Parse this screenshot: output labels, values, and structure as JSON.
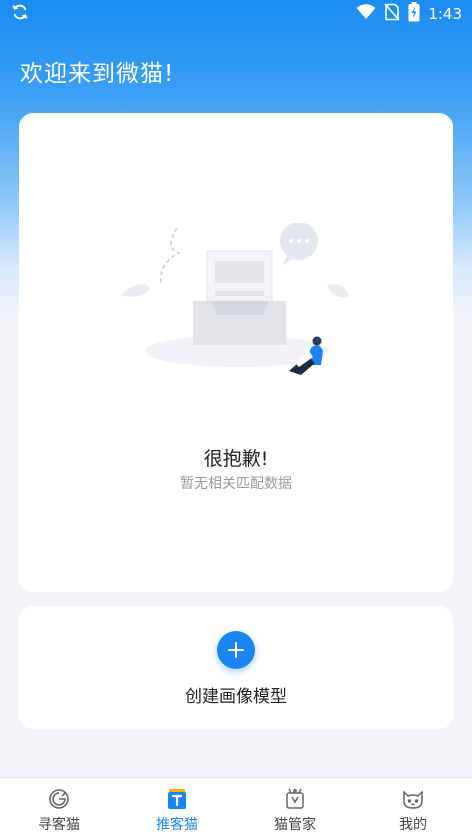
{
  "status_bar": {
    "time": "1:43",
    "icons": [
      "sync-icon",
      "wifi-icon",
      "no-sim-icon",
      "battery-charging-icon"
    ]
  },
  "greeting": "欢迎来到微猫!",
  "empty_state": {
    "title": "很抱歉!",
    "subtitle": "暂无相关匹配数据",
    "illustration": "empty-inbox-illustration"
  },
  "create_model": {
    "label": "创建画像模型",
    "icon": "plus-icon"
  },
  "tabbar": {
    "items": [
      {
        "label": "寻客猫",
        "icon": "search-cat-icon",
        "active": false
      },
      {
        "label": "推客猫",
        "icon": "t-badge-icon",
        "active": true
      },
      {
        "label": "猫管家",
        "icon": "butler-icon",
        "active": false
      },
      {
        "label": "我的",
        "icon": "cat-face-icon",
        "active": false
      }
    ]
  },
  "colors": {
    "primary": "#1a84f2",
    "header_top": "#1a8cf0",
    "background": "#f4f5f9"
  }
}
